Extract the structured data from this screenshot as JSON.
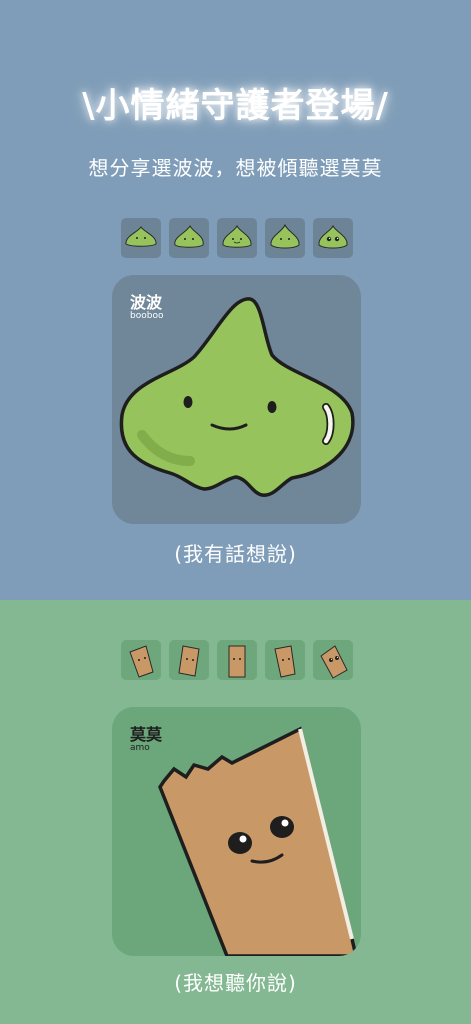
{
  "header": {
    "title": "\\小情緒守護者登場/",
    "subtitle": "想分享選波波，想被傾聽選莫莫"
  },
  "booboo": {
    "name": "波波",
    "name_en": "booboo",
    "caption": "(我有話想說)",
    "body_color": "#97c35c"
  },
  "amo": {
    "name": "莫莫",
    "name_en": "amo",
    "caption": "(我想聽你說)",
    "body_color": "#c99867"
  }
}
